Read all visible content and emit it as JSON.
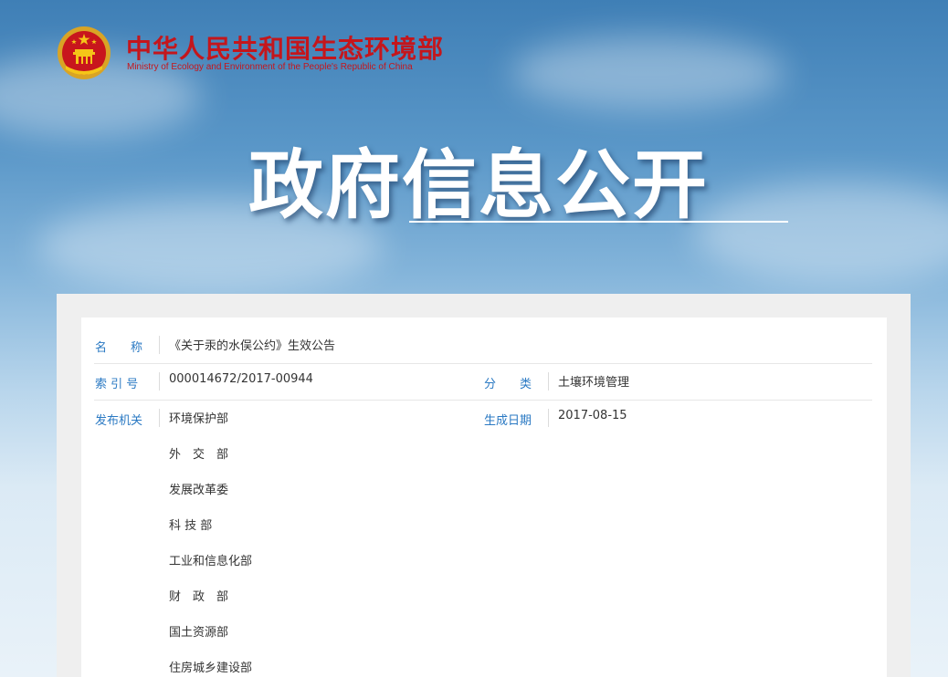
{
  "header": {
    "org_name_cn": "中华人民共和国生态环境部",
    "org_name_en": "Ministry of Ecology and Environment of the People's Republic of China",
    "banner_title": "政府信息公开"
  },
  "document": {
    "name_label": "名　　称",
    "name_value": "《关于汞的水俣公约》生效公告",
    "index_label": "索 引 号",
    "index_value": "000014672/2017-00944",
    "category_label": "分　　类",
    "category_value": "土壤环境管理",
    "issuer_label": "发布机关",
    "date_label": "生成日期",
    "date_value": "2017-08-15",
    "issuers": [
      "环境保护部",
      "外　交　部",
      "发展改革委",
      "科 技 部",
      "工业和信息化部",
      "财　政　部",
      "国土资源部",
      "住房城乡建设部"
    ]
  },
  "colors": {
    "label_blue": "#2a79c3",
    "brand_red": "#c4161c"
  },
  "icons": {
    "emblem": "national-emblem-icon"
  }
}
